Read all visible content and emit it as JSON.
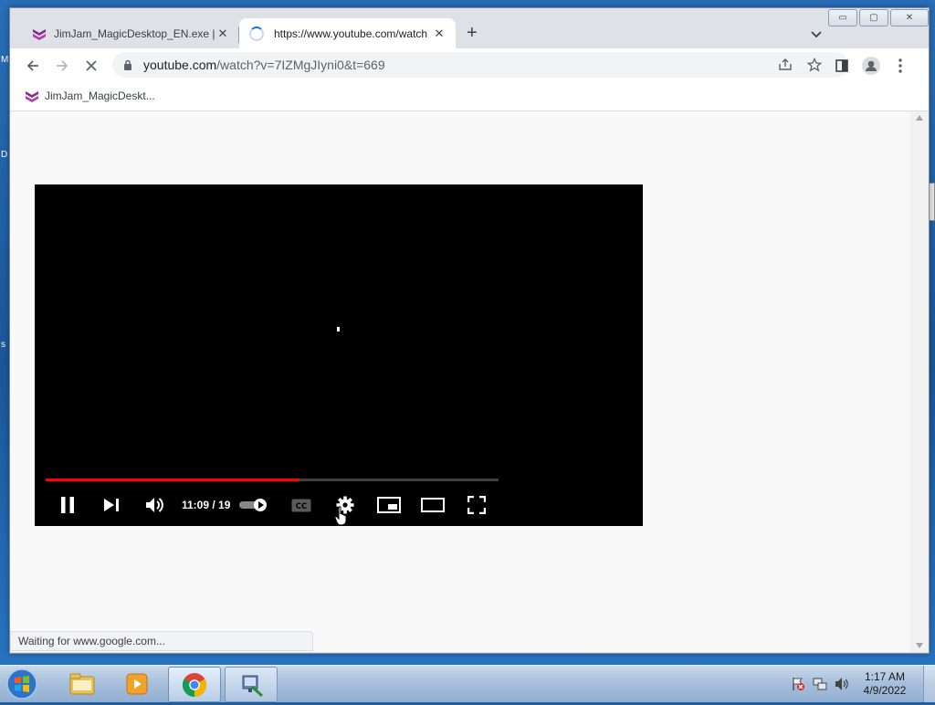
{
  "desktop": {
    "letters": [
      "M",
      "D",
      "s"
    ]
  },
  "window": {
    "caption": {
      "minimize": "▭",
      "maximize": "▢",
      "close": "✕"
    }
  },
  "tabs": [
    {
      "title": "JimJam_MagicDesktop_EN.exe | S",
      "close": "✕",
      "favicon": "jimjam-logo-icon"
    },
    {
      "title": "https://www.youtube.com/watch",
      "close": "✕",
      "favicon": "loading-spinner-icon"
    }
  ],
  "toolbar": {
    "url_host": "youtube.com",
    "url_path": "/watch?v=7IZMgJIyni0&t=669"
  },
  "bookmarks": [
    {
      "label": "JimJam_MagicDeskt..."
    }
  ],
  "player": {
    "time": "11:09 / 19",
    "progress_fraction": 0.56,
    "controls": [
      "pause-icon",
      "next-icon",
      "volume-icon",
      "autoplay-toggle",
      "cc-icon",
      "settings-icon",
      "miniplayer-icon",
      "theater-icon",
      "fullscreen-icon"
    ]
  },
  "status_bar": {
    "text": "Waiting for www.google.com..."
  },
  "taskbar": {
    "apps": [
      "windows-explorer-icon",
      "media-player-icon",
      "chrome-icon",
      "network-app-icon"
    ],
    "clock": {
      "time": "1:17 AM",
      "date": "4/9/2022"
    }
  },
  "colors": {
    "progress": "#ff0000",
    "player_bg": "#000000",
    "chrome_tab_bg": "#dee1e6"
  }
}
